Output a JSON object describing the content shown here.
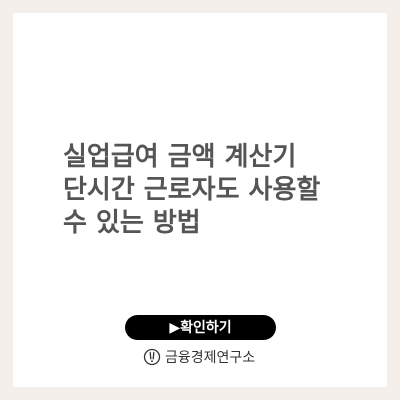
{
  "title": {
    "line1": "실업급여 금액 계산기",
    "line2": "단시간 근로자도 사용할",
    "line3": "수 있는 방법"
  },
  "cta": {
    "label": "▶확인하기"
  },
  "brand": {
    "icon": "exclamation-circle-icon",
    "name": "금융경제연구소"
  },
  "colors": {
    "background": "#f4efea",
    "card": "#ffffff",
    "title_text": "#555555",
    "button": "#000000",
    "button_text": "#ffffff"
  }
}
